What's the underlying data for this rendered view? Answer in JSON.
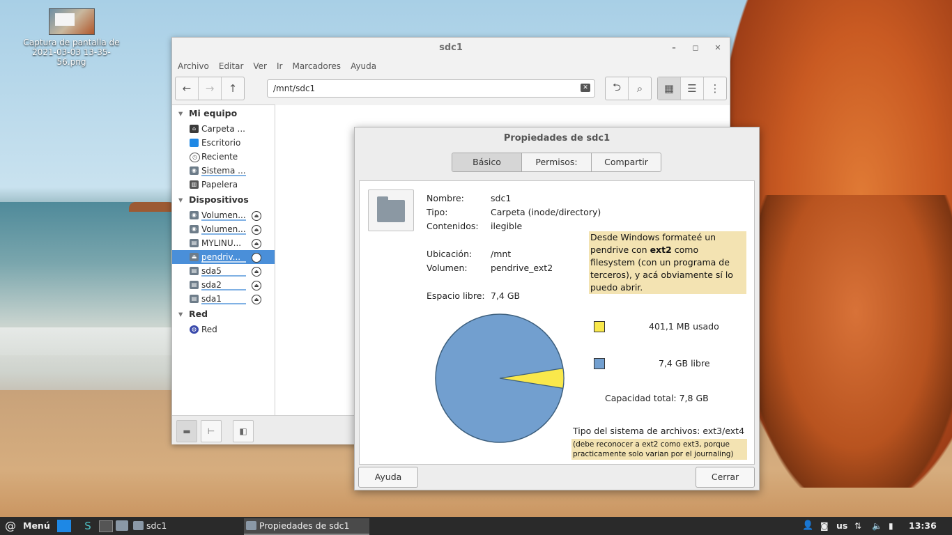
{
  "desktop": {
    "icon_label": "Captura de pantalla de 2021-03-03 13-35-56.png"
  },
  "file_manager": {
    "title": "sdc1",
    "window_buttons": {
      "minimize": "–",
      "maximize": "◻",
      "close": "✕"
    },
    "menu": [
      "Archivo",
      "Editar",
      "Ver",
      "Ir",
      "Marcadores",
      "Ayuda"
    ],
    "path": "/mnt/sdc1",
    "sidebar": {
      "sections": [
        {
          "title": "Mi equipo",
          "items": [
            "Carpeta ...",
            "Escritorio",
            "Reciente",
            "Sistema ...",
            "Papelera"
          ]
        },
        {
          "title": "Dispositivos",
          "items": [
            "Volumen...",
            "Volumen...",
            "MYLINU...",
            "pendriv...",
            "sda5",
            "sda2",
            "sda1"
          ]
        },
        {
          "title": "Red",
          "items": [
            "Red"
          ]
        }
      ]
    }
  },
  "dialog": {
    "title": "Propiedades de sdc1",
    "tabs": [
      "Básico",
      "Permisos:",
      "Compartir"
    ],
    "fields": {
      "nombre_label": "Nombre:",
      "nombre": "sdc1",
      "tipo_label": "Tipo:",
      "tipo": "Carpeta (inode/directory)",
      "contenidos_label": "Contenidos:",
      "contenidos": "ilegible",
      "ubicacion_label": "Ubicación:",
      "ubicacion": "/mnt",
      "volumen_label": "Volumen:",
      "volumen": "pendrive_ext2",
      "espacio_label": "Espacio libre:",
      "espacio": "7,4 GB"
    },
    "annotation_top_parts": [
      "Desde Windows formateé un pendrive con ",
      "ext2",
      " como filesystem (con un programa de terceros), y acá obviamente sí lo puedo abrir."
    ],
    "legend": [
      {
        "label": "401,1 MB usado",
        "color": "#f9e84b"
      },
      {
        "label": "7,4 GB libre",
        "color": "#729fcf"
      }
    ],
    "capacity": "Capacidad total: 7,8 GB",
    "fs_type": "Tipo del sistema de archivos: ext3/ext4",
    "annotation_bottom": "(debe reconocer a ext2 como ext3, porque practicamente solo varian por el journaling)",
    "used_fraction": 0.05,
    "buttons": {
      "help": "Ayuda",
      "close": "Cerrar"
    }
  },
  "taskbar": {
    "menu_label": "Menú",
    "tasks": [
      "sdc1",
      "Propiedades de sdc1"
    ],
    "keyboard": "us",
    "clock": "13:36"
  }
}
